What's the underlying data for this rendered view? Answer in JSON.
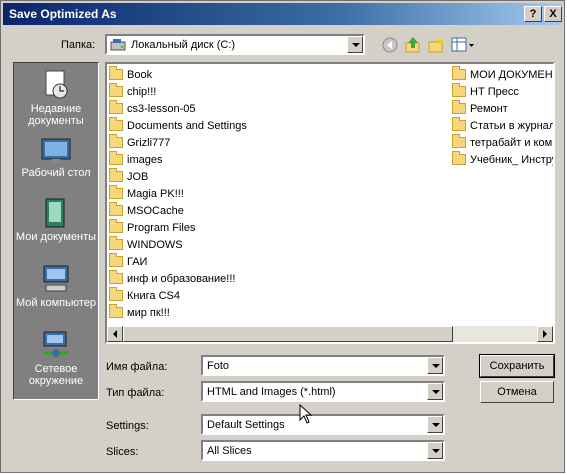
{
  "window": {
    "title": "Save Optimized As",
    "help_glyph": "?",
    "close_glyph": "X"
  },
  "toolbar": {
    "location_label": "Папка:",
    "location_value": "Локальный диск (C:)"
  },
  "places": [
    {
      "label": "Недавние документы",
      "icon": "recent-documents-icon"
    },
    {
      "label": "Рабочий стол",
      "icon": "desktop-icon"
    },
    {
      "label": "Мои документы",
      "icon": "my-documents-icon"
    },
    {
      "label": "Мой компьютер",
      "icon": "my-computer-icon"
    },
    {
      "label": "Сетевое окружение",
      "icon": "network-icon"
    }
  ],
  "files": {
    "column1": [
      "Book",
      "chip!!!",
      "cs3-lesson-05",
      "Documents and Settings",
      "Grizli777",
      "images",
      "JOB",
      "Magia PK!!!",
      "MSOCache",
      "Program Files",
      "WINDOWS",
      "ГАИ",
      "инф и образование!!!",
      "Книга CS4",
      "мир пк!!!"
    ],
    "column2": [
      "МОИ ДОКУМЕНТЫ",
      "НТ Пресс",
      "Ремонт",
      "Статьи в журнал",
      "тетрабайт и ком",
      "Учебник_ Инстру"
    ]
  },
  "form": {
    "filename_label": "Имя файла:",
    "filename_value": "Foto",
    "filetype_label": "Тип файла:",
    "filetype_value": "HTML and Images (*.html)",
    "settings_label": "Settings:",
    "settings_value": "Default Settings",
    "slices_label": "Slices:",
    "slices_value": "All Slices"
  },
  "buttons": {
    "save": "Сохранить",
    "cancel": "Отмена"
  },
  "colors": {
    "title_start": "#0a246a",
    "title_end": "#a6caf0",
    "face": "#d4d0c8",
    "places_bg": "#808080"
  }
}
